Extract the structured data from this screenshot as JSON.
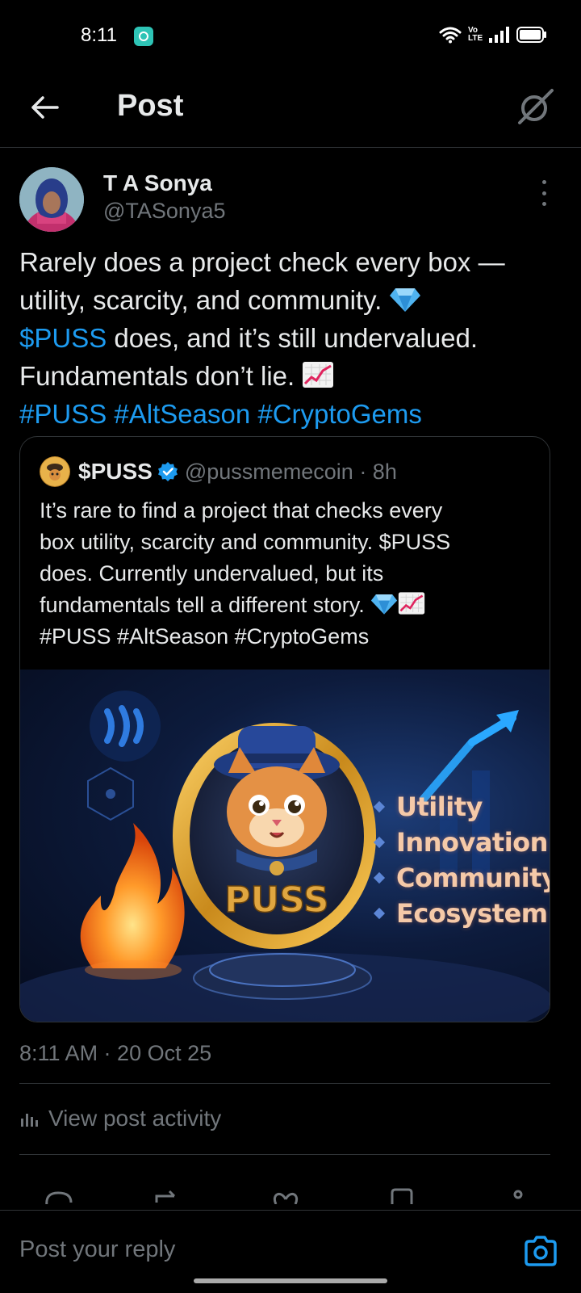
{
  "status_bar": {
    "time": "8:11",
    "network_label": "Vo LTE"
  },
  "header": {
    "title": "Post"
  },
  "post": {
    "author_name": "T A Sonya",
    "author_handle": "@TASonya5",
    "text_line1": "Rarely does a project check every box —",
    "text_line2": "utility, scarcity, and community.",
    "text_cashtag": "$PUSS",
    "text_line3": " does, and it’s still undervalued.",
    "text_line4": "Fundamentals don’t lie.",
    "hashtags": "#PUSS #AltSeason #CryptoGems",
    "timestamp": "8:11 AM · 20 Oct 25",
    "view_activity": "View post activity"
  },
  "quote": {
    "name": "$PUSS",
    "handle": "@pussmemecoin · 8h",
    "text_line1": "It’s rare to find a project that checks every",
    "text_line2": "box utility, scarcity and community. $PUSS",
    "text_line3": "does. Currently undervalued, but its",
    "text_line4": "fundamentals tell a different story.",
    "text_line5": "#PUSS #AltSeason #CryptoGems",
    "image": {
      "coin_label": "PUSS",
      "features": [
        "Utility",
        "Innovation",
        "Community",
        "Ecosystem"
      ]
    }
  },
  "reply": {
    "placeholder": "Post your reply"
  },
  "colors": {
    "accent": "#1d9bf0",
    "muted": "#71767b",
    "border": "#2f3336",
    "background": "#000000"
  }
}
